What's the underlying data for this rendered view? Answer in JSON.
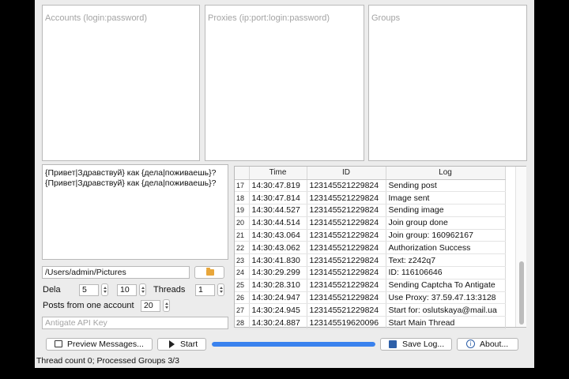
{
  "panes": {
    "accounts_placeholder": "Accounts (login:password)",
    "proxies_placeholder": "Proxies (ip:port:login:password)",
    "groups_placeholder": "Groups"
  },
  "messages": {
    "line1": "{Привет|Здравствуй} как {дела|поживаешь}?",
    "line2": "{Привет|Здравствуй} как {дела|поживаешь}?"
  },
  "settings": {
    "path": "/Users/admin/Pictures",
    "dela_label": "Dela",
    "dela_from": "5",
    "dela_to": "10",
    "threads_label": "Threads",
    "threads": "1",
    "posts_label": "Posts from one account",
    "posts": "20",
    "api_key_placeholder": "Antigate API Key"
  },
  "log": {
    "columns": [
      "",
      "Time",
      "ID",
      "Log"
    ],
    "rows": [
      [
        "17",
        "14:30:47.819",
        "123145521229824",
        "Sending post"
      ],
      [
        "18",
        "14:30:47.814",
        "123145521229824",
        "Image sent"
      ],
      [
        "19",
        "14:30:44.527",
        "123145521229824",
        "Sending image"
      ],
      [
        "20",
        "14:30:44.514",
        "123145521229824",
        "Join group done"
      ],
      [
        "21",
        "14:30:43.064",
        "123145521229824",
        "Join group: 160962167"
      ],
      [
        "22",
        "14:30:43.062",
        "123145521229824",
        "Authorization Success"
      ],
      [
        "23",
        "14:30:41.830",
        "123145521229824",
        "Text: z242q7"
      ],
      [
        "24",
        "14:30:29.299",
        "123145521229824",
        "ID: 116106646"
      ],
      [
        "25",
        "14:30:28.310",
        "123145521229824",
        "Sending Captcha To Antigate"
      ],
      [
        "26",
        "14:30:24.947",
        "123145521229824",
        "Use Proxy: 37.59.47.13:3128"
      ],
      [
        "27",
        "14:30:24.945",
        "123145521229824",
        "Start for: oslutskaya@mail.ua"
      ],
      [
        "28",
        "14:30:24.887",
        "123145519620096",
        "Start Main Thread"
      ]
    ]
  },
  "toolbar": {
    "preview_label": "Preview Messages...",
    "start_label": "Start",
    "save_log_label": "Save Log...",
    "about_label": "About..."
  },
  "progress": {
    "value": 1.0
  },
  "status": "Thread count 0; Processed Groups 3/3",
  "colors": {
    "progress_fill": "#3a82ee",
    "folder": "#e8a63a"
  }
}
